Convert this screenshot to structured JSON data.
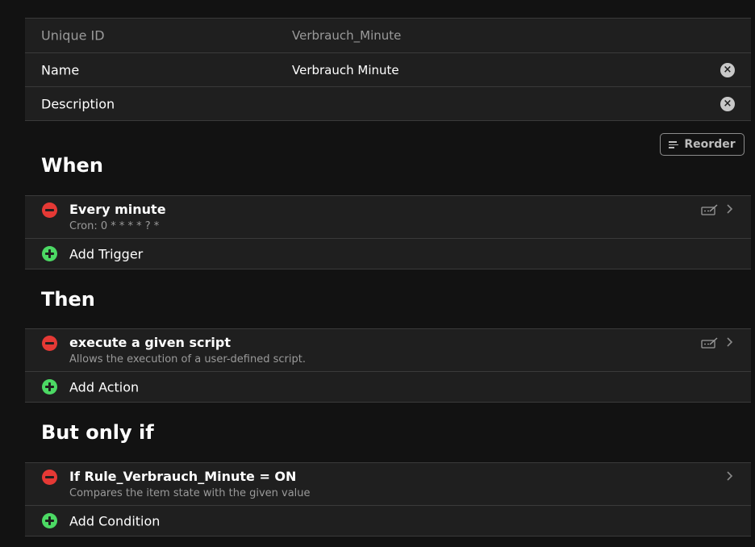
{
  "info": {
    "uid_label": "Unique ID",
    "uid_value": "Verbrauch_Minute",
    "name_label": "Name",
    "name_value": "Verbrauch Minute",
    "description_label": "Description",
    "description_value": ""
  },
  "toolbar": {
    "reorder_label": "Reorder"
  },
  "when": {
    "title": "When",
    "modules": [
      {
        "title": "Every minute",
        "subtitle": "Cron: 0 * * * * ? *"
      }
    ],
    "add_label": "Add Trigger"
  },
  "then": {
    "title": "Then",
    "modules": [
      {
        "title": "execute a given script",
        "subtitle": "Allows the execution of a user-defined script."
      }
    ],
    "add_label": "Add Action"
  },
  "but_only_if": {
    "title": "But only if",
    "modules": [
      {
        "title": "If Rule_Verbrauch_Minute = ON",
        "subtitle": "Compares the item state with the given value"
      }
    ],
    "add_label": "Add Condition"
  },
  "icons": {
    "remove": "minus-circle-icon",
    "add": "plus-circle-icon",
    "clear": "clear-circle-icon",
    "edit": "script-edit-icon",
    "chevron": "chevron-right-icon",
    "reorder": "sort-lines-icon"
  },
  "colors": {
    "background": "#121212",
    "panel": "#1f1f1f",
    "remove": "#e53935",
    "add": "#4cd964",
    "muted_text": "#9a9a9a"
  }
}
